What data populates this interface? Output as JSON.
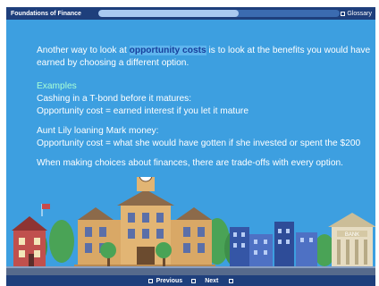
{
  "header": {
    "course_title": "Foundations of Finance",
    "glossary_label": "Glossary",
    "progress_fraction": 0.58
  },
  "content": {
    "intro_before": "Another way to look at ",
    "intro_highlight": "opportunity costs",
    "intro_after": " is to look at the benefits you would have earned by choosing a different option.",
    "examples_heading": "Examples",
    "example1_line1": "Cashing in a T-bond before it matures:",
    "example1_line2": "Opportunity cost = earned interest if you let it mature",
    "example2_line1": "Aunt Lily loaning Mark money:",
    "example2_line2": "Opportunity cost = what she would have gotten if she invested or spent the $200",
    "closing": "When making choices about finances, there are trade-offs with every option."
  },
  "illustration": {
    "bank_sign": "BANK"
  },
  "footer": {
    "previous_label": "Previous",
    "next_label": "Next"
  },
  "colors": {
    "stage_blue": "#3d9fe0",
    "bar_navy": "#1e3f7c",
    "highlight_text": "#173f9c",
    "examples_green": "#a8ffd6"
  }
}
